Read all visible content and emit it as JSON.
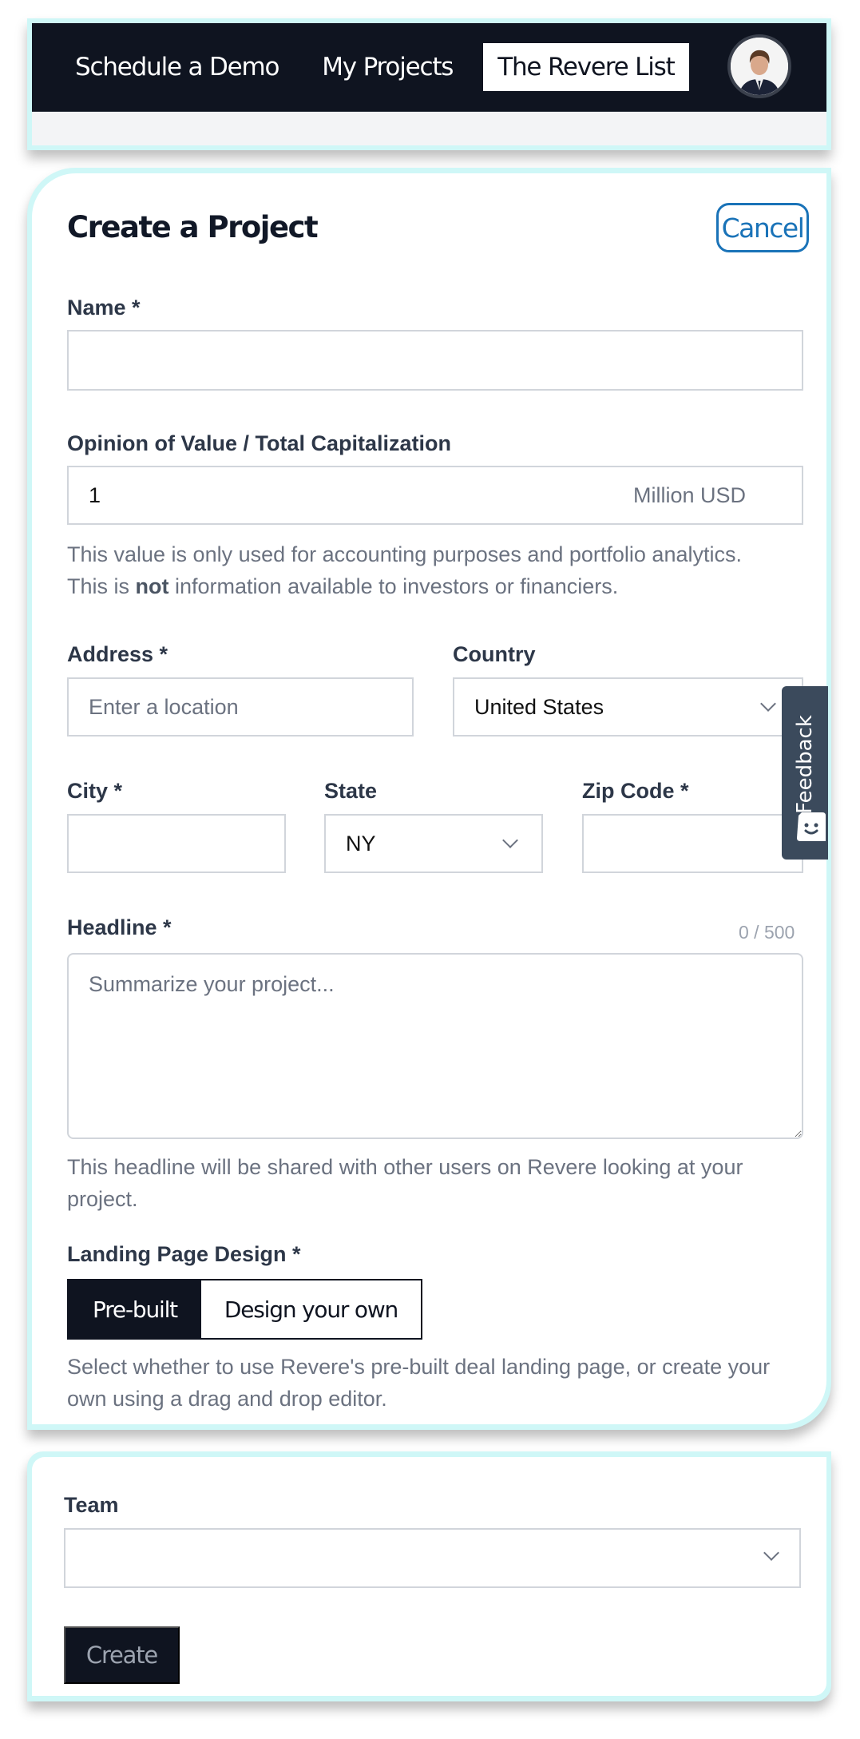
{
  "nav": {
    "links": [
      {
        "label": "Schedule a Demo",
        "active": false
      },
      {
        "label": "My Projects",
        "active": false
      },
      {
        "label": "The Revere List",
        "active": true
      }
    ],
    "avatar_icon": "user-avatar"
  },
  "form": {
    "title": "Create a Project",
    "cancel_label": "Cancel",
    "name": {
      "label": "Name *",
      "value": ""
    },
    "valuation": {
      "label": "Opinion of Value / Total Capitalization",
      "value": "1",
      "suffix": "Million USD",
      "help_prefix": "This value is only used for accounting purposes and portfolio analytics.",
      "help_line2_start": "This is ",
      "help_bold": "not",
      "help_line2_end": " information available to investors or financiers."
    },
    "address": {
      "label": "Address *",
      "placeholder": "Enter a location",
      "value": ""
    },
    "country": {
      "label": "Country",
      "selected": "United States"
    },
    "city": {
      "label": "City *",
      "value": ""
    },
    "state": {
      "label": "State",
      "selected": "NY"
    },
    "zip": {
      "label": "Zip Code *",
      "value": ""
    },
    "headline": {
      "label": "Headline *",
      "counter": "0 / 500",
      "placeholder": "Summarize your project...",
      "help": "This headline will be shared with other users on Revere looking at your project."
    },
    "landing": {
      "label": "Landing Page Design *",
      "options": [
        {
          "label": "Pre-built",
          "selected": true
        },
        {
          "label": "Design your own",
          "selected": false
        }
      ],
      "help": "Select whether to use Revere's pre-built deal landing page, or create your own using a drag and drop editor."
    }
  },
  "feedback": {
    "label": "Feedback",
    "icon": "smiley-chat-icon"
  },
  "team": {
    "label": "Team",
    "selected": ""
  },
  "create_label": "Create",
  "colors": {
    "nav_bg": "#0f1420",
    "accent_border": "#cff7f7",
    "cancel_blue": "#1a73b8",
    "feedback_bg": "#3b4a5c"
  }
}
